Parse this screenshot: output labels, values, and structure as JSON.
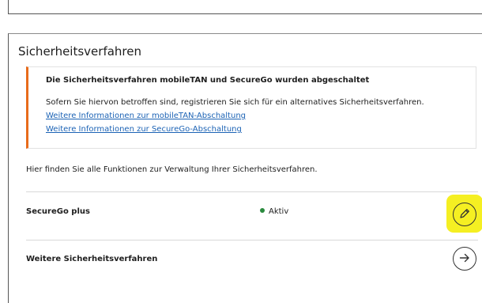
{
  "section": {
    "title": "Sicherheitsverfahren",
    "intro": "Hier finden Sie alle Funktionen zur Verwaltung Ihrer Sicherheitsverfahren."
  },
  "notice": {
    "title": "Die Sicherheitsverfahren mobileTAN und SecureGo wurden abgeschaltet",
    "text": "Sofern Sie hiervon betroffen sind, registrieren Sie sich für ein alternatives Sicherheitsverfahren.",
    "link_mobiletan": "Weitere Informationen zur mobileTAN-Abschaltung",
    "link_securego": "Weitere Informationen zur SecureGo-Abschaltung",
    "accent_color": "#e86b1b"
  },
  "rows": {
    "securego": {
      "label": "SecureGo plus",
      "status": "Aktiv",
      "status_color": "#2a8a3e",
      "action_icon": "pencil-icon"
    },
    "more": {
      "label": "Weitere Sicherheitsverfahren",
      "action_icon": "arrow-right-icon"
    }
  },
  "colors": {
    "link": "#1c63b5",
    "highlight": "#f5ef22"
  }
}
